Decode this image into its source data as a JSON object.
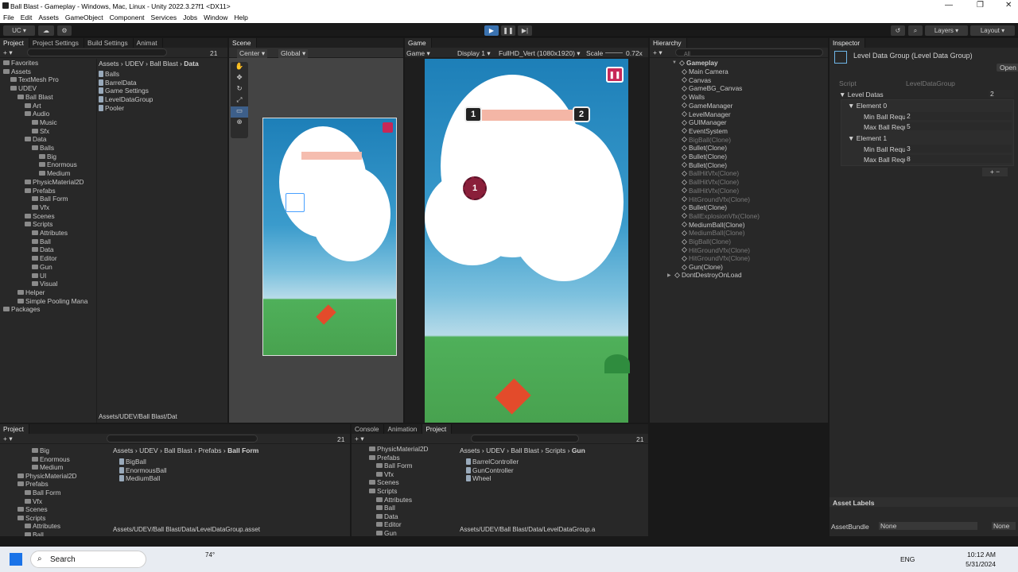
{
  "window": {
    "title": "Ball Blast - Gameplay - Windows, Mac, Linux - Unity 2022.3.27f1 <DX11>"
  },
  "menu": [
    "File",
    "Edit",
    "Assets",
    "GameObject",
    "Component",
    "Services",
    "Jobs",
    "Window",
    "Help"
  ],
  "toolbar": {
    "account": "UC",
    "layers": "Layers",
    "layout": "Layout"
  },
  "project_panel": {
    "tabs": [
      "Project",
      "Project Settings",
      "Build Settings",
      "Animat"
    ],
    "count": "21",
    "breadcrumb": [
      "Assets",
      "UDEV",
      "Ball Blast",
      "Data"
    ],
    "tree": [
      {
        "label": "Favorites",
        "indent": 0
      },
      {
        "label": "Assets",
        "indent": 0
      },
      {
        "label": "TextMesh Pro",
        "indent": 1
      },
      {
        "label": "UDEV",
        "indent": 1
      },
      {
        "label": "Ball Blast",
        "indent": 2
      },
      {
        "label": "Art",
        "indent": 3
      },
      {
        "label": "Audio",
        "indent": 3
      },
      {
        "label": "Music",
        "indent": 4
      },
      {
        "label": "Sfx",
        "indent": 4
      },
      {
        "label": "Data",
        "indent": 3
      },
      {
        "label": "Balls",
        "indent": 4
      },
      {
        "label": "Big",
        "indent": 5
      },
      {
        "label": "Enormous",
        "indent": 5
      },
      {
        "label": "Medium",
        "indent": 5
      },
      {
        "label": "PhysicMaterial2D",
        "indent": 3
      },
      {
        "label": "Prefabs",
        "indent": 3
      },
      {
        "label": "Ball Form",
        "indent": 4
      },
      {
        "label": "Vfx",
        "indent": 4
      },
      {
        "label": "Scenes",
        "indent": 3
      },
      {
        "label": "Scripts",
        "indent": 3
      },
      {
        "label": "Attributes",
        "indent": 4
      },
      {
        "label": "Ball",
        "indent": 4
      },
      {
        "label": "Data",
        "indent": 4
      },
      {
        "label": "Editor",
        "indent": 4
      },
      {
        "label": "Gun",
        "indent": 4
      },
      {
        "label": "UI",
        "indent": 4
      },
      {
        "label": "Visual",
        "indent": 4
      },
      {
        "label": "Helper",
        "indent": 2
      },
      {
        "label": "Simple Pooling Mana",
        "indent": 2
      },
      {
        "label": "Packages",
        "indent": 0
      }
    ],
    "files": [
      "Balls",
      "BarrelData",
      "Game Settings",
      "LevelDataGroup",
      "Pooler"
    ],
    "footer": "Assets/UDEV/Ball Blast/Dat"
  },
  "scene": {
    "tab": "Scene",
    "pivot": "Center",
    "space": "Global"
  },
  "game": {
    "tab": "Game",
    "mode": "Game",
    "display": "Display 1",
    "resolution": "FullHD_Vert (1080x1920)",
    "scale_label": "Scale",
    "scale": "0.72x",
    "ball_value": "1",
    "bar_left": "1",
    "bar_right": "2"
  },
  "hierarchy": {
    "tab": "Hierarchy",
    "search_placeholder": "All",
    "scene": "Gameplay",
    "items": [
      {
        "label": "Main Camera",
        "dim": false
      },
      {
        "label": "Canvas",
        "dim": false
      },
      {
        "label": "GameBG_Canvas",
        "dim": false
      },
      {
        "label": "Walls",
        "dim": false
      },
      {
        "label": "GameManager",
        "dim": false
      },
      {
        "label": "LevelManager",
        "dim": false
      },
      {
        "label": "GUIManager",
        "dim": false
      },
      {
        "label": "EventSystem",
        "dim": false
      },
      {
        "label": "BigBall(Clone)",
        "dim": true
      },
      {
        "label": "Bullet(Clone)",
        "dim": false
      },
      {
        "label": "Bullet(Clone)",
        "dim": false
      },
      {
        "label": "Bullet(Clone)",
        "dim": false
      },
      {
        "label": "BallHitVfx(Clone)",
        "dim": true
      },
      {
        "label": "BallHitVfx(Clone)",
        "dim": true
      },
      {
        "label": "BallHitVfx(Clone)",
        "dim": true
      },
      {
        "label": "HitGroundVfx(Clone)",
        "dim": true
      },
      {
        "label": "Bullet(Clone)",
        "dim": false
      },
      {
        "label": "BallExplosionVfx(Clone)",
        "dim": true
      },
      {
        "label": "MediumBall(Clone)",
        "dim": false
      },
      {
        "label": "MediumBall(Clone)",
        "dim": true
      },
      {
        "label": "BigBall(Clone)",
        "dim": true
      },
      {
        "label": "HitGroundVfx(Clone)",
        "dim": true
      },
      {
        "label": "HitGroundVfx(Clone)",
        "dim": true
      },
      {
        "label": "Gun(Clone)",
        "dim": false
      }
    ],
    "dont_destroy": "DontDestroyOnLoad"
  },
  "inspector": {
    "tab": "Inspector",
    "title": "Level Data Group (Level Data Group)",
    "open": "Open",
    "script_label": "Script",
    "script_value": "LevelDataGroup",
    "list_label": "Level Datas",
    "list_count": "2",
    "elements": [
      {
        "name": "Element 0",
        "min_label": "Min Ball Requ",
        "min": "2",
        "max_label": "Max Ball Requ",
        "max": "5"
      },
      {
        "name": "Element 1",
        "min_label": "Min Ball Requ",
        "min": "3",
        "max_label": "Max Ball Requ",
        "max": "8"
      }
    ],
    "asset_labels": "Asset Labels",
    "bundle_label": "AssetBundle",
    "bundle_value": "None",
    "variant_value": "None"
  },
  "bottom_left": {
    "tab": "Project",
    "count": "21",
    "breadcrumb": [
      "Assets",
      "UDEV",
      "Ball Blast",
      "Prefabs",
      "Ball Form"
    ],
    "tree": [
      {
        "label": "Big",
        "indent": 4
      },
      {
        "label": "Enormous",
        "indent": 4
      },
      {
        "label": "Medium",
        "indent": 4
      },
      {
        "label": "PhysicMaterial2D",
        "indent": 2
      },
      {
        "label": "Prefabs",
        "indent": 2
      },
      {
        "label": "Ball Form",
        "indent": 3
      },
      {
        "label": "Vfx",
        "indent": 3
      },
      {
        "label": "Scenes",
        "indent": 2
      },
      {
        "label": "Scripts",
        "indent": 2
      },
      {
        "label": "Attributes",
        "indent": 3
      },
      {
        "label": "Ball",
        "indent": 3
      }
    ],
    "files": [
      "BigBall",
      "EnormousBall",
      "MediumBall"
    ],
    "footer": "Assets/UDEV/Ball Blast/Data/LevelDataGroup.asset"
  },
  "bottom_right": {
    "tabs": [
      "Console",
      "Animation",
      "Project"
    ],
    "count": "21",
    "breadcrumb": [
      "Assets",
      "UDEV",
      "Ball Blast",
      "Scripts",
      "Gun"
    ],
    "tree": [
      {
        "label": "PhysicMaterial2D",
        "indent": 2
      },
      {
        "label": "Prefabs",
        "indent": 2
      },
      {
        "label": "Ball Form",
        "indent": 3
      },
      {
        "label": "Vfx",
        "indent": 3
      },
      {
        "label": "Scenes",
        "indent": 2
      },
      {
        "label": "Scripts",
        "indent": 2
      },
      {
        "label": "Attributes",
        "indent": 3
      },
      {
        "label": "Ball",
        "indent": 3
      },
      {
        "label": "Data",
        "indent": 3
      },
      {
        "label": "Editor",
        "indent": 3
      },
      {
        "label": "Gun",
        "indent": 3
      }
    ],
    "files": [
      "BarrelController",
      "GunController",
      "Wheel"
    ],
    "footer": "Assets/UDEV/Ball Blast/Data/LevelDataGroup.a"
  },
  "taskbar": {
    "search": "Search",
    "lang": "ENG",
    "time": "10:12 AM",
    "date": "5/31/2024",
    "weather": "74°"
  }
}
